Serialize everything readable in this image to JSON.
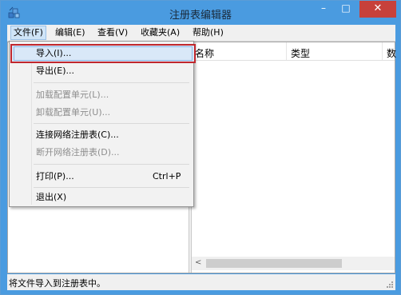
{
  "window": {
    "title": "注册表编辑器",
    "minimize_glyph": "–",
    "maximize_glyph": "□",
    "close_glyph": "✕"
  },
  "menubar": {
    "file": "文件(F)",
    "edit": "编辑(E)",
    "view": "查看(V)",
    "favorites": "收藏夹(A)",
    "help": "帮助(H)"
  },
  "file_menu": {
    "import": "导入(I)...",
    "export": "导出(E)...",
    "load_hive": "加载配置单元(L)...",
    "unload_hive": "卸载配置单元(U)...",
    "connect": "连接网络注册表(C)...",
    "disconnect": "断开网络注册表(D)...",
    "print": "打印(P)...",
    "print_shortcut": "Ctrl+P",
    "exit": "退出(X)"
  },
  "columns": {
    "name": "名称",
    "type": "类型",
    "data": "数"
  },
  "status": {
    "text": "将文件导入到注册表中。"
  },
  "colors": {
    "titlebar": "#4a9be0",
    "close": "#c7413b",
    "highlight_border": "#c1272d"
  }
}
